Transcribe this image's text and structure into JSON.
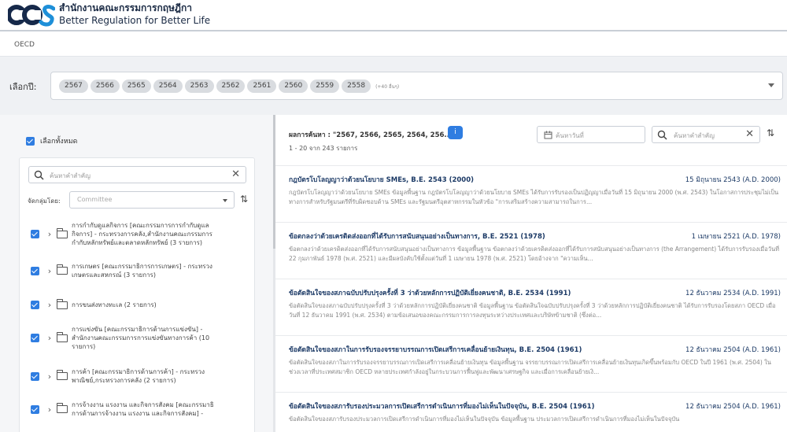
{
  "header": {
    "logo_text": "OCS",
    "title_th": "สำนักงานคณะกรรมการกฤษฎีกา",
    "title_en": "Better Regulation for Better Life"
  },
  "breadcrumb": "OECD",
  "year_filter": {
    "label": "เลือกปี:",
    "chips": [
      "2567",
      "2566",
      "2565",
      "2564",
      "2563",
      "2562",
      "2561",
      "2560",
      "2559",
      "2558"
    ],
    "more": "(+40 อื่นๆ)"
  },
  "left_panel": {
    "select_all": "เลือกทั้งหมด",
    "search_placeholder": "ค้นหาคำสำคัญ",
    "group_label": "จัดกลุ่มโดย:",
    "group_placeholder": "Committee",
    "tree": [
      {
        "lines": [
          "การกำกับดูแลกิจการ [คณะกรรมการการกำกับดูแล",
          "กิจการ] - กระทรวงการคลัง,สำนักงานคณะกรรมการ",
          "กำกับหลักทรัพย์และตลาดหลักทรัพย์ (3 รายการ)"
        ]
      },
      {
        "lines": [
          "การเกษตร [คณะกรรมาธิการการเกษตร] - กระทรวง",
          "เกษตรและสหกรณ์ (3 รายการ)"
        ]
      },
      {
        "lines": [
          "การขนส่งทางทะเล (2 รายการ)"
        ]
      },
      {
        "lines": [
          "การแข่งขัน [คณะกรรมาธิการด้านการแข่งขัน] -",
          "สำนักงานคณะกรรมการการแข่งขันทางการค้า (10",
          "รายการ)"
        ]
      },
      {
        "lines": [
          "การค้า [คณะกรรมาธิการด้านการค้า] - กระทรวง",
          "พาณิชย์,กระทรวงการคลัง (2 รายการ)"
        ]
      },
      {
        "lines": [
          "การจ้างงาน แรงงาน และกิจการสังคม [คณะกรรมาธิ",
          "การด้านการจ้างงาน แรงงาน และกิจการสังคม] -"
        ]
      }
    ]
  },
  "right_panel": {
    "result_title": "ผลการค้นหา : \"2567, 2566, 2565, 2564, 256...",
    "badge": "i",
    "count": "1 - 20 จาก 243 รายการ",
    "date_placeholder": "ค้นหาวันที่",
    "search_placeholder": "ค้นหาคำสำคัญ",
    "results": [
      {
        "title": "กฎบัตรโบโลญญาว่าด้วยนโยบาย SMEs, B.E. 2543 (2000)",
        "date": "15 มิถุนายน 2543 (A.D. 2000)",
        "snippet": "กฎบัตรโบโลญญาว่าด้วยนโยบาย SMEs ข้อมูลพื้นฐาน กฎบัตรโบโลญญาว่าด้วยนโยบาย SMEs ได้รับการรับรองเป็นปฏิญญาเมื่อวันที่ 15 มิถุนายน 2000 (พ.ศ. 2543) ในโอกาสการประชุมไม่เป็นทางการสำหรับรัฐมนตรีที่รับผิดชอบด้าน SMEs และรัฐมนตรีอุตสาหกรรมในหัวข้อ \"การเสริมสร้างความสามารถในการ..."
      },
      {
        "title": "ข้อตกลงว่าด้วยเครดิตส่งออกที่ได้รับการสนับสนุนอย่างเป็นทางการ, B.E. 2521 (1978)",
        "date": "1 เมษายน 2521 (A.D. 1978)",
        "snippet": "ข้อตกลงว่าด้วยเครดิตส่งออกที่ได้รับการสนับสนุนอย่างเป็นทางการ ข้อมูลพื้นฐาน ข้อตกลงว่าด้วยเครดิตส่งออกที่ได้รับการสนับสนุนอย่างเป็นทางการ (the Arrangement) ได้รับการรับรองเมื่อวันที่ 22 กุมภาพันธ์ 1978 (พ.ศ. 2521) และมีผลบังคับใช้ตั้งแต่วันที่ 1 เมษายน 1978 (พ.ศ. 2521) โดยอ้างจาก \"ความเห็น..."
      },
      {
        "title": "ข้อตัดสินใจของสภาฉบับปรับปรุงครั้งที่ 3 ว่าด้วยหลักการปฏิบัติเยี่ยงคนชาติ, B.E. 2534 (1991)",
        "date": "12 ธันวาคม 2534 (A.D. 1991)",
        "snippet": "ข้อตัดสินใจของสภาฉบับปรับปรุงครั้งที่ 3 ว่าด้วยหลักการปฏิบัติเยี่ยงคนชาติ ข้อมูลพื้นฐาน ข้อตัดสินใจฉบับปรับปรุงครั้งที่ 3 ว่าด้วยหลักการปฏิบัติเยี่ยงคนชาติ ได้รับการรับรองโดยสภา OECD เมื่อวันที่ 12 ธันวาคม 1991 (พ.ศ. 2534) ตามข้อเสนอของคณะกรรมการการลงทุนระหว่างประเทศและบริษัทข้ามชาติ (ซึ่งต่อ..."
      },
      {
        "title": "ข้อตัดสินใจของสภาในการรับรองจรรยาบรรณการเปิดเสรีการเคลื่อนย้ายเงินทุน, B.E. 2504 (1961)",
        "date": "12 ธันวาคม 2504 (A.D. 1961)",
        "snippet": "ข้อตัดสินใจของสภาในการรับรองจรรยาบรรณการเปิดเสรีการเคลื่อนย้ายเงินทุน ข้อมูลพื้นฐาน จรรยาบรรณการเปิดเสรีการเคลื่อนย้ายเงินทุนเกิดขึ้นพร้อมกับ OECD ในปี 1961 (พ.ศ. 2504) ในช่วงเวลาที่ประเทศสมาชิก OECD หลายประเทศกำลังอยู่ในกระบวนการฟื้นฟูและพัฒนาเศรษฐกิจ และเมื่อการเคลื่อนย้ายเงิ..."
      },
      {
        "title": "ข้อตัดสินใจของสภารับรองประมวลการเปิดเสรีการดำเนินการที่มองไม่เห็นในปัจจุบัน, B.E. 2504 (1961)",
        "date": "12 ธันวาคม 2504 (A.D. 1961)",
        "snippet": "ข้อตัดสินใจของสภารับรองประมวลการเปิดเสรีการดำเนินการที่มองไม่เห็นในปัจจุบัน ข้อมูลพื้นฐาน ประมวลการเปิดเสรีการดำเนินการที่มองไม่เห็นในปัจจุบัน"
      }
    ]
  }
}
